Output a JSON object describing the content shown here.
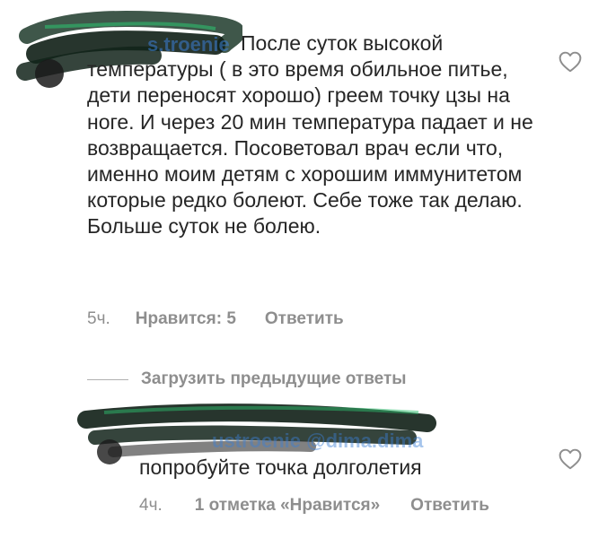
{
  "comments": [
    {
      "username": "s.troenie",
      "text": "После суток высокой температуры ( в это время обильное питье, дети переносят хорошо) греем точку цзы на ноге. И через 20 мин температура падает и не возвращается. Посоветовал врач если что, именно моим детям с хорошим иммунитетом которые редко болеют. Себе тоже так делаю. Больше суток не болею.",
      "time": "5ч.",
      "likes": "Нравится: 5",
      "reply": "Ответить",
      "icon": "heart-outline-icon"
    },
    {
      "username": "ustroenie @dima.dima",
      "text": "попробуйте точка долголетия",
      "time": "4ч.",
      "likes": "1 отметка «Нравится»",
      "reply": "Ответить",
      "icon": "heart-outline-icon"
    }
  ],
  "load_previous": "Загрузить предыдущие ответы",
  "colors": {
    "text": "#262626",
    "meta": "#8e8e8e",
    "mention": "#3b7fd6",
    "scribble": "#0f1f16"
  }
}
